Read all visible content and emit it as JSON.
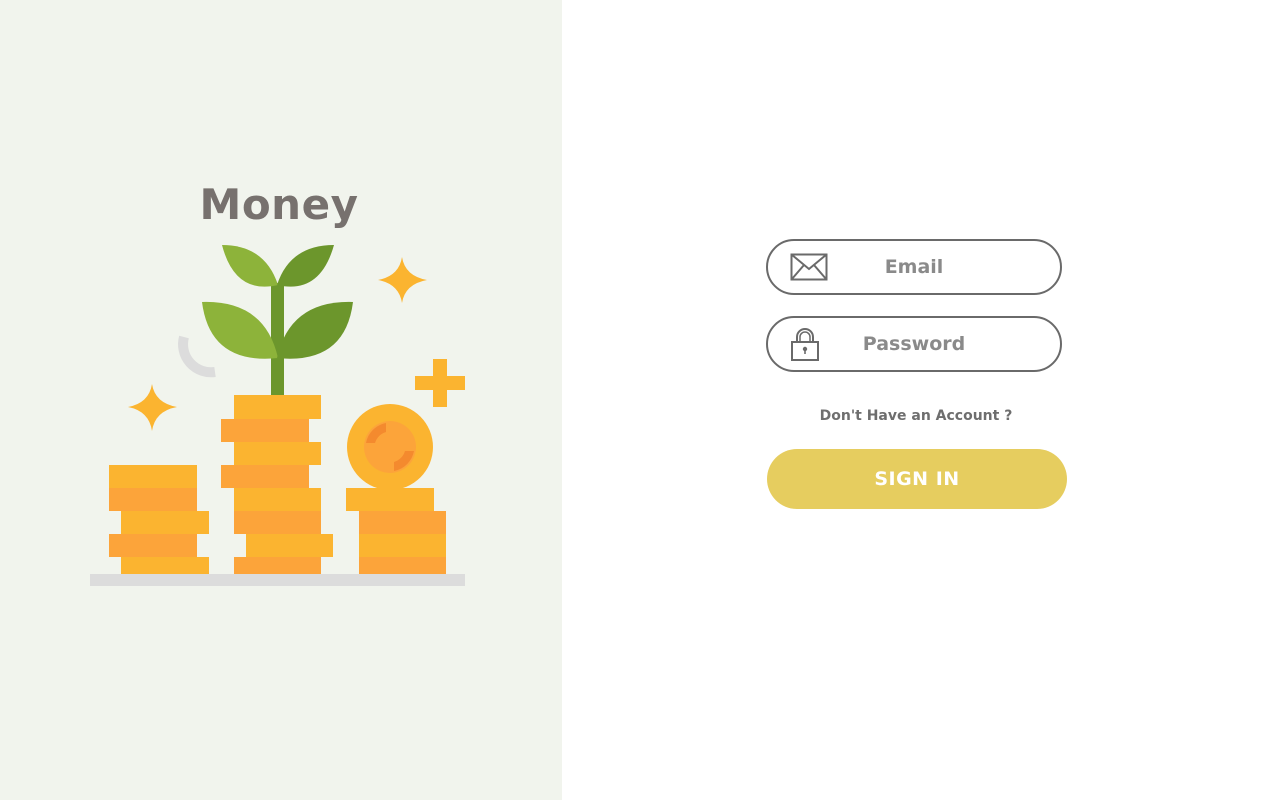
{
  "brand": {
    "title": "Money"
  },
  "form": {
    "email_placeholder": "Email",
    "password_placeholder": "Password",
    "account_link": "Don't Have an Account ?",
    "signin_label": "SIGN IN"
  },
  "icons": {
    "email": "envelope-icon",
    "password": "lock-icon"
  },
  "colors": {
    "left_background": "#f1f4ed",
    "accent_button": "#e6cd5f",
    "field_border": "#6a6a6a",
    "title_text": "#77716e",
    "coin_yellow": "#fbb430",
    "coin_orange": "#fca43a",
    "leaf_green": "#8db33a",
    "leaf_dark_green": "#6c962c"
  }
}
